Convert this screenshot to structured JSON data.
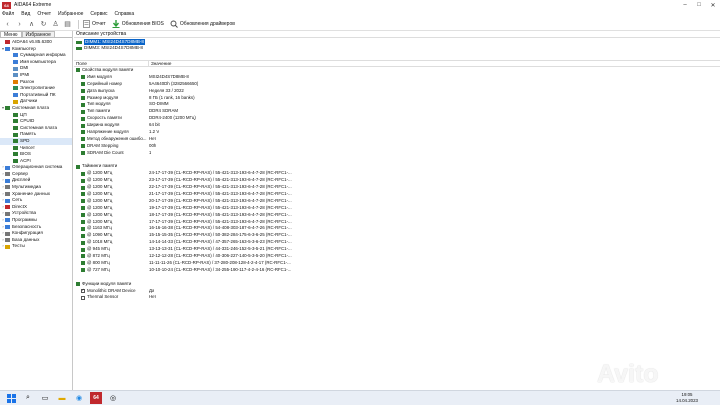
{
  "window": {
    "title": "AIDA64 Extreme",
    "logo_text": "64"
  },
  "menu": [
    "Файл",
    "Вид",
    "Отчет",
    "Избранное",
    "Сервис",
    "Справка"
  ],
  "toolbar": {
    "report_label": "Отчет",
    "bios_update_label": "Обновления BIOS",
    "driver_update_label": "Обновления драйверов"
  },
  "left_tabs": {
    "menu": "Меню",
    "favorites": "Избранное"
  },
  "tree": [
    {
      "label": "AIDA64 v6.85.6300",
      "indent": 0,
      "exp": "",
      "color": "#c0282d"
    },
    {
      "label": "Компьютер",
      "indent": 0,
      "exp": "v",
      "color": "#3b7dd8"
    },
    {
      "label": "Суммарная информа",
      "indent": 2,
      "exp": "",
      "color": "#3b7dd8"
    },
    {
      "label": "Имя компьютера",
      "indent": 2,
      "exp": "",
      "color": "#3b7dd8"
    },
    {
      "label": "DMI",
      "indent": 2,
      "exp": "",
      "color": "#5c8fc4"
    },
    {
      "label": "IPMI",
      "indent": 2,
      "exp": "",
      "color": "#5c8fc4"
    },
    {
      "label": "Разгон",
      "indent": 2,
      "exp": "",
      "color": "#e07b00"
    },
    {
      "label": "Электропитание",
      "indent": 2,
      "exp": "",
      "color": "#2e8b57"
    },
    {
      "label": "Портативный ПК",
      "indent": 2,
      "exp": "",
      "color": "#3b7dd8"
    },
    {
      "label": "Датчики",
      "indent": 2,
      "exp": "",
      "color": "#d9a400"
    },
    {
      "label": "Системная плата",
      "indent": 0,
      "exp": "v",
      "color": "#2e7d32"
    },
    {
      "label": "ЦП",
      "indent": 2,
      "exp": "",
      "color": "#2e7d32"
    },
    {
      "label": "CPUID",
      "indent": 2,
      "exp": "",
      "color": "#2e7d32"
    },
    {
      "label": "Системная плата",
      "indent": 2,
      "exp": "",
      "color": "#2e7d32"
    },
    {
      "label": "Память",
      "indent": 2,
      "exp": "",
      "color": "#2e7d32"
    },
    {
      "label": "SPD",
      "indent": 2,
      "exp": "",
      "color": "#2e7d32",
      "selected": true
    },
    {
      "label": "Чипсет",
      "indent": 2,
      "exp": "",
      "color": "#2e7d32"
    },
    {
      "label": "BIOS",
      "indent": 2,
      "exp": "",
      "color": "#2e7d32"
    },
    {
      "label": "ACPI",
      "indent": 2,
      "exp": "",
      "color": "#2e7d32"
    },
    {
      "label": "Операционная система",
      "indent": 0,
      "exp": ">",
      "color": "#3b7dd8"
    },
    {
      "label": "Сервер",
      "indent": 0,
      "exp": ">",
      "color": "#777777"
    },
    {
      "label": "Дисплей",
      "indent": 0,
      "exp": ">",
      "color": "#3b7dd8"
    },
    {
      "label": "Мультимедиа",
      "indent": 0,
      "exp": ">",
      "color": "#777777"
    },
    {
      "label": "Хранение данных",
      "indent": 0,
      "exp": ">",
      "color": "#777777"
    },
    {
      "label": "Сеть",
      "indent": 0,
      "exp": ">",
      "color": "#3b7dd8"
    },
    {
      "label": "DirectX",
      "indent": 0,
      "exp": ">",
      "color": "#c0282d"
    },
    {
      "label": "Устройства",
      "indent": 0,
      "exp": ">",
      "color": "#777777"
    },
    {
      "label": "Программы",
      "indent": 0,
      "exp": ">",
      "color": "#3b7dd8"
    },
    {
      "label": "Безопасность",
      "indent": 0,
      "exp": ">",
      "color": "#3b7dd8"
    },
    {
      "label": "Конфигурация",
      "indent": 0,
      "exp": ">",
      "color": "#777777"
    },
    {
      "label": "База данных",
      "indent": 0,
      "exp": ">",
      "color": "#777777"
    },
    {
      "label": "Тесты",
      "indent": 0,
      "exp": ">",
      "color": "#d9a400"
    }
  ],
  "device_panel": {
    "title": "Описание устройства",
    "devices": [
      {
        "label": "DIMM1: MSI24D4S7D8MB-8",
        "selected": true
      },
      {
        "label": "DIMM3: MSI24D4S7D8MB-8",
        "selected": false
      }
    ]
  },
  "grid_headers": {
    "field": "Поле",
    "value": "Значение"
  },
  "properties": [
    {
      "type": "section",
      "key": "Свойства модуля памяти",
      "value": ""
    },
    {
      "type": "item",
      "key": "Имя модуля",
      "value": "MSI24D4S7D8MB-8"
    },
    {
      "type": "item",
      "key": "Серийный номер",
      "value": "5A4640Dh (3282566650)"
    },
    {
      "type": "item",
      "key": "Дата выпуска",
      "value": "Неделя 33 / 2022"
    },
    {
      "type": "item",
      "key": "Размер модуля",
      "value": "8 ГБ (1 rank, 16 banks)"
    },
    {
      "type": "item",
      "key": "Тип модуля",
      "value": "SO-DIMM"
    },
    {
      "type": "item",
      "key": "Тип памяти",
      "value": "DDR4 SDRAM"
    },
    {
      "type": "item",
      "key": "Скорость памяти",
      "value": "DDR4-2400 (1200 МГц)"
    },
    {
      "type": "item",
      "key": "Ширина модуля",
      "value": "64 bit"
    },
    {
      "type": "item",
      "key": "Напряжение модуля",
      "value": "1.2 V"
    },
    {
      "type": "item",
      "key": "Метод обнаружения ошибо...",
      "value": "Нет"
    },
    {
      "type": "item",
      "key": "DRAM Stepping",
      "value": "00h"
    },
    {
      "type": "item",
      "key": "SDRAM Die Count",
      "value": "1"
    },
    {
      "type": "blank",
      "key": "",
      "value": ""
    },
    {
      "type": "section",
      "key": "Тайминги памяти",
      "value": ""
    },
    {
      "type": "item",
      "key": "@ 1200 МГц",
      "value": "24-17-17-39  (CL-RCD-RP-RAS) / 55-421-313-193-6-4-7-28  (RC-RFC1-..."
    },
    {
      "type": "item",
      "key": "@ 1200 МГц",
      "value": "23-17-17-39  (CL-RCD-RP-RAS) / 55-421-313-193-6-4-7-28  (RC-RFC1-..."
    },
    {
      "type": "item",
      "key": "@ 1200 МГц",
      "value": "22-17-17-39  (CL-RCD-RP-RAS) / 55-421-313-193-6-4-7-28  (RC-RFC1-..."
    },
    {
      "type": "item",
      "key": "@ 1200 МГц",
      "value": "21-17-17-39  (CL-RCD-RP-RAS) / 55-421-313-193-6-4-7-28  (RC-RFC1-..."
    },
    {
      "type": "item",
      "key": "@ 1200 МГц",
      "value": "20-17-17-39  (CL-RCD-RP-RAS) / 55-421-313-193-6-4-7-28  (RC-RFC1-..."
    },
    {
      "type": "item",
      "key": "@ 1200 МГц",
      "value": "19-17-17-39  (CL-RCD-RP-RAS) / 55-421-313-193-6-4-7-28  (RC-RFC1-..."
    },
    {
      "type": "item",
      "key": "@ 1200 МГц",
      "value": "18-17-17-39  (CL-RCD-RP-RAS) / 55-421-313-193-6-4-7-28  (RC-RFC1-..."
    },
    {
      "type": "item",
      "key": "@ 1200 МГц",
      "value": "17-17-17-39  (CL-RCD-RP-RAS) / 55-421-313-193-6-4-7-28  (RC-RFC1-..."
    },
    {
      "type": "item",
      "key": "@ 1163 МГц",
      "value": "16-16-16-38  (CL-RCD-RP-RAS) / 54-408-303-187-6-4-7-26  (RC-RFC1-..."
    },
    {
      "type": "item",
      "key": "@ 1090 МГц",
      "value": "15-15-15-35  (CL-RCD-RP-RAS) / 50-382-284-175-6-3-6-25  (RC-RFC1-..."
    },
    {
      "type": "item",
      "key": "@ 1018 МГц",
      "value": "14-14-14-33  (CL-RCD-RP-RAS) / 47-357-265-163-5-3-6-23  (RC-RFC1-..."
    },
    {
      "type": "item",
      "key": "@ 945 МГц",
      "value": "13-13-13-31  (CL-RCD-RP-RAS) / 44-331-246-152-5-3-5-21  (RC-RFC1-..."
    },
    {
      "type": "item",
      "key": "@ 872 МГц",
      "value": "12-12-12-28  (CL-RCD-RP-RAS) / 40-306-227-140-5-3-5-20  (RC-RFC1-..."
    },
    {
      "type": "item",
      "key": "@ 800 МГц",
      "value": "11-11-11-26  (CL-RCD-RP-RAS) / 37-280-208-128-4-2-4-17  (RC-RFC1-..."
    },
    {
      "type": "item",
      "key": "@ 727 МГц",
      "value": "10-10-10-24  (CL-RCD-RP-RAS) / 34-255-190-117-4-2-4-16  (RC-RFC1-..."
    },
    {
      "type": "blank",
      "key": "",
      "value": ""
    },
    {
      "type": "section",
      "key": "Функции модуля памяти",
      "value": ""
    },
    {
      "type": "check",
      "key": "Monolithic DRAM Device",
      "value": "Да",
      "checked": true
    },
    {
      "type": "check",
      "key": "Thermal Sensor",
      "value": "Нет",
      "checked": false
    }
  ],
  "taskbar": {
    "time": "19:05",
    "date": "14.04.2023",
    "app_label": "64"
  },
  "watermark": "Avito",
  "colors": {
    "selection": "#0a64c8",
    "chip": "#2e7d32",
    "logo": "#c0282d"
  }
}
